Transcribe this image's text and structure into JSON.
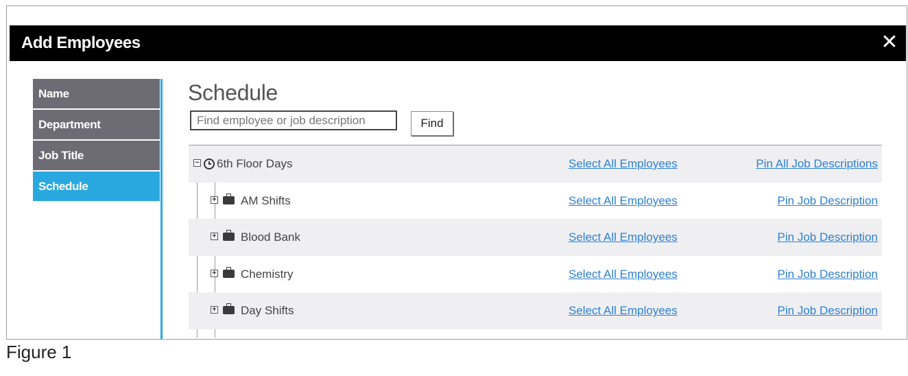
{
  "dialog": {
    "title": "Add Employees",
    "close_glyph": "✕"
  },
  "nav": {
    "items": [
      {
        "label": "Name",
        "active": false
      },
      {
        "label": "Department",
        "active": false
      },
      {
        "label": "Job Title",
        "active": false
      },
      {
        "label": "Schedule",
        "active": true
      }
    ]
  },
  "main": {
    "heading": "Schedule",
    "search": {
      "placeholder": "Find employee or job description",
      "value": ""
    },
    "find_label": "Find"
  },
  "tree": {
    "root": {
      "label": "6th Floor Days",
      "icon": "clock-icon",
      "toggle": "−",
      "select_label": "Select All Employees",
      "pin_label": "Pin All Job Descriptions"
    },
    "children": [
      {
        "label": "AM Shifts",
        "icon": "briefcase-icon",
        "toggle": "+",
        "select_label": "Select All Employees",
        "pin_label": "Pin Job Description"
      },
      {
        "label": "Blood Bank",
        "icon": "briefcase-icon",
        "toggle": "+",
        "select_label": "Select All Employees",
        "pin_label": "Pin Job Description"
      },
      {
        "label": "Chemistry",
        "icon": "briefcase-icon",
        "toggle": "+",
        "select_label": "Select All Employees",
        "pin_label": "Pin Job Description"
      },
      {
        "label": "Day Shifts",
        "icon": "briefcase-icon",
        "toggle": "+",
        "select_label": "Select All Employees",
        "pin_label": "Pin Job Description"
      }
    ]
  },
  "caption": "Figure 1",
  "colors": {
    "accent": "#29a8e0",
    "nav_bg": "#6d6b74",
    "link": "#2d7fd6",
    "titlebar": "#000000"
  }
}
